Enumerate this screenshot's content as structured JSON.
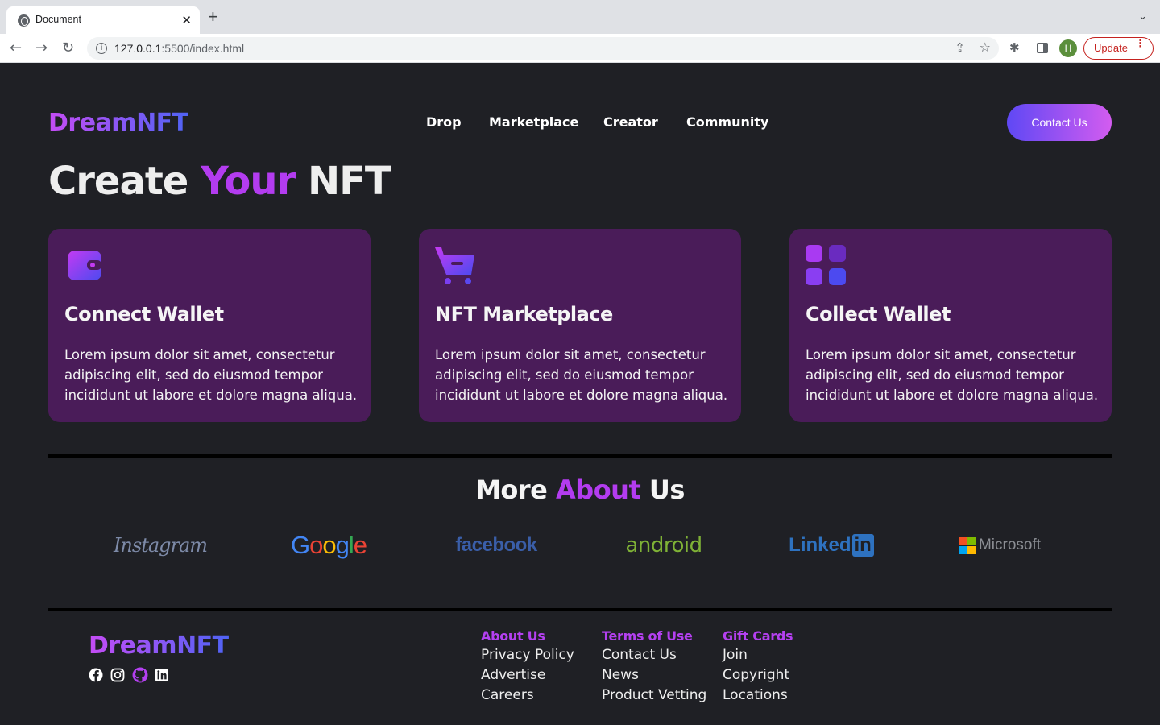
{
  "browser": {
    "tab_title": "Document",
    "tab_close": "✕",
    "new_tab": "+",
    "url_host": "127.0.0.1",
    "url_rest": ":5500/index.html",
    "profile_initial": "H",
    "update_label": "Update"
  },
  "header": {
    "logo_part1": "Dream",
    "logo_part2": "NFT",
    "nav": [
      "Drop",
      "Marketplace",
      "Creator",
      "Community"
    ],
    "contact_label": "Contact Us"
  },
  "hero": {
    "title_part1": "Create",
    "title_part2": "Your",
    "title_part3": "NFT"
  },
  "cards": [
    {
      "icon": "wallet-icon",
      "title": "Connect Wallet",
      "text": "Lorem ipsum dolor sit amet, consectetur adipiscing elit, sed do eiusmod tempor incididunt ut labore et dolore magna aliqua."
    },
    {
      "icon": "cart-icon",
      "title": "NFT Marketplace",
      "text": "Lorem ipsum dolor sit amet, consectetur adipiscing elit, sed do eiusmod tempor incididunt ut labore et dolore magna aliqua."
    },
    {
      "icon": "grid-icon",
      "title": "Collect Wallet",
      "text": "Lorem ipsum dolor sit amet, consectetur adipiscing elit, sed do eiusmod tempor incididunt ut labore et dolore magna aliqua."
    }
  ],
  "about": {
    "title_part1": "More",
    "title_part2": "About",
    "title_part3": "Us",
    "brands": [
      "Instagram",
      "Google",
      "facebook",
      "android",
      "Linked",
      "in",
      "Microsoft"
    ]
  },
  "footer": {
    "logo_part1": "Dream",
    "logo_part2": "NFT",
    "social_icons": [
      "facebook-icon",
      "instagram-icon",
      "github-icon",
      "linkedin-icon"
    ],
    "columns": [
      {
        "heading": "About Us",
        "links": [
          "Privacy Policy",
          "Advertise",
          "Careers"
        ]
      },
      {
        "heading": "Terms of Use",
        "links": [
          "Contact Us",
          "News",
          "Product Vetting"
        ]
      },
      {
        "heading": "Gift Cards",
        "links": [
          "Join",
          "Copyright",
          "Locations"
        ]
      }
    ]
  },
  "colors": {
    "background": "#1f2025",
    "card": "#4a1c59",
    "accent": "#b33cf0",
    "gradient_start": "#c54cf5",
    "gradient_end": "#4f63f5"
  }
}
